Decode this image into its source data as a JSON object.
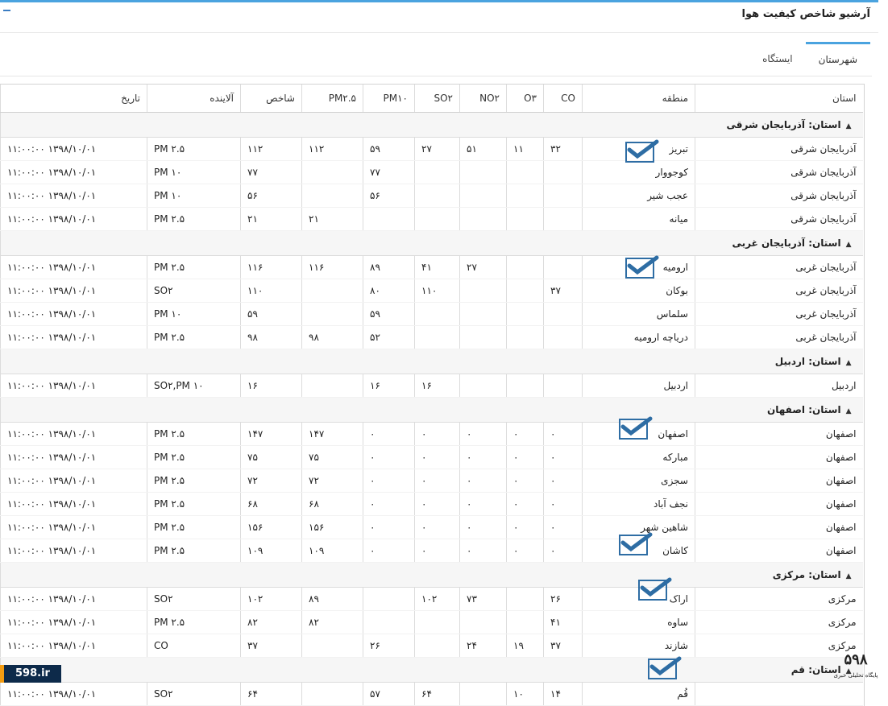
{
  "panel": {
    "title": "آرشیو شاخص کیفیت هوا"
  },
  "tabs": [
    {
      "label": "شهرستان",
      "active": true
    },
    {
      "label": "ایستگاه",
      "active": false
    }
  ],
  "columns": [
    "استان",
    "منطقه",
    "CO",
    "O۳",
    "NO۲",
    "SO۲",
    "PM۱۰",
    "PM۲.۵",
    "شاخص",
    "آلاینده",
    "تاریخ"
  ],
  "groups": [
    {
      "label": "استان: آذربایجان شرقی",
      "rows": [
        [
          "آذربایجان شرقی",
          "تبریز",
          "۳۲",
          "۱۱",
          "۵۱",
          "۲۷",
          "۵۹",
          "۱۱۲",
          "۱۱۲",
          "PM ۲.۵",
          "۱۱:۰۰:۰۰ ۱۳۹۸/۱۰/۰۱"
        ],
        [
          "آذربایجان شرقی",
          "کوجووار",
          "",
          "",
          "",
          "",
          "۷۷",
          "",
          "۷۷",
          "PM ۱۰",
          "۱۱:۰۰:۰۰ ۱۳۹۸/۱۰/۰۱"
        ],
        [
          "آذربایجان شرقی",
          "عجب شیر",
          "",
          "",
          "",
          "",
          "۵۶",
          "",
          "۵۶",
          "PM ۱۰",
          "۱۱:۰۰:۰۰ ۱۳۹۸/۱۰/۰۱"
        ],
        [
          "آذربایجان شرقی",
          "میانه",
          "",
          "",
          "",
          "",
          "",
          "۲۱",
          "۲۱",
          "PM ۲.۵",
          "۱۱:۰۰:۰۰ ۱۳۹۸/۱۰/۰۱"
        ]
      ]
    },
    {
      "label": "استان: آذربایجان غربی",
      "rows": [
        [
          "آذربایجان غربی",
          "ارومیه",
          "",
          "",
          "۲۷",
          "۴۱",
          "۸۹",
          "۱۱۶",
          "۱۱۶",
          "PM ۲.۵",
          "۱۱:۰۰:۰۰ ۱۳۹۸/۱۰/۰۱"
        ],
        [
          "آذربایجان غربی",
          "بوکان",
          "۳۷",
          "",
          "",
          "۱۱۰",
          "۸۰",
          "",
          "۱۱۰",
          "SO۲",
          "۱۱:۰۰:۰۰ ۱۳۹۸/۱۰/۰۱"
        ],
        [
          "آذربایجان غربی",
          "سلماس",
          "",
          "",
          "",
          "",
          "۵۹",
          "",
          "۵۹",
          "PM ۱۰",
          "۱۱:۰۰:۰۰ ۱۳۹۸/۱۰/۰۱"
        ],
        [
          "آذربایجان غربی",
          "دریاچه ارومیه",
          "",
          "",
          "",
          "",
          "۵۲",
          "۹۸",
          "۹۸",
          "PM ۲.۵",
          "۱۱:۰۰:۰۰ ۱۳۹۸/۱۰/۰۱"
        ]
      ]
    },
    {
      "label": "استان: اردبیل",
      "rows": [
        [
          "اردبیل",
          "اردبیل",
          "",
          "",
          "",
          "۱۶",
          "۱۶",
          "",
          "۱۶",
          "SO۲,PM ۱۰",
          "۱۱:۰۰:۰۰ ۱۳۹۸/۱۰/۰۱"
        ]
      ]
    },
    {
      "label": "استان: اصفهان",
      "rows": [
        [
          "اصفهان",
          "اصفهان",
          "۰",
          "۰",
          "۰",
          "۰",
          "۰",
          "۱۴۷",
          "۱۴۷",
          "PM ۲.۵",
          "۱۱:۰۰:۰۰ ۱۳۹۸/۱۰/۰۱"
        ],
        [
          "اصفهان",
          "مبارکه",
          "۰",
          "۰",
          "۰",
          "۰",
          "۰",
          "۷۵",
          "۷۵",
          "PM ۲.۵",
          "۱۱:۰۰:۰۰ ۱۳۹۸/۱۰/۰۱"
        ],
        [
          "اصفهان",
          "سجزی",
          "۰",
          "۰",
          "۰",
          "۰",
          "۰",
          "۷۲",
          "۷۲",
          "PM ۲.۵",
          "۱۱:۰۰:۰۰ ۱۳۹۸/۱۰/۰۱"
        ],
        [
          "اصفهان",
          "نجف آباد",
          "۰",
          "۰",
          "۰",
          "۰",
          "۰",
          "۶۸",
          "۶۸",
          "PM ۲.۵",
          "۱۱:۰۰:۰۰ ۱۳۹۸/۱۰/۰۱"
        ],
        [
          "اصفهان",
          "شاهین شهر",
          "۰",
          "۰",
          "۰",
          "۰",
          "۰",
          "۱۵۶",
          "۱۵۶",
          "PM ۲.۵",
          "۱۱:۰۰:۰۰ ۱۳۹۸/۱۰/۰۱"
        ],
        [
          "اصفهان",
          "کاشان",
          "۰",
          "۰",
          "۰",
          "۰",
          "۰",
          "۱۰۹",
          "۱۰۹",
          "PM ۲.۵",
          "۱۱:۰۰:۰۰ ۱۳۹۸/۱۰/۰۱"
        ]
      ]
    },
    {
      "label": "استان: مرکزی",
      "rows": [
        [
          "مرکزی",
          "اراک",
          "۲۶",
          "",
          "۷۳",
          "۱۰۲",
          "",
          "۸۹",
          "۱۰۲",
          "SO۲",
          "۱۱:۰۰:۰۰ ۱۳۹۸/۱۰/۰۱"
        ],
        [
          "مرکزی",
          "ساوه",
          "۴۱",
          "",
          "",
          "",
          "",
          "۸۲",
          "۸۲",
          "PM ۲.۵",
          "۱۱:۰۰:۰۰ ۱۳۹۸/۱۰/۰۱"
        ],
        [
          "مرکزی",
          "شازند",
          "۳۷",
          "۱۹",
          "۲۴",
          "",
          "۲۶",
          "",
          "۳۷",
          "CO",
          "۱۱:۰۰:۰۰ ۱۳۹۸/۱۰/۰۱"
        ]
      ]
    },
    {
      "label": "استان: قم",
      "rows": [
        [
          "",
          "قُم",
          "۱۴",
          "۱۰",
          "",
          "۶۴",
          "۵۷",
          "",
          "۶۴",
          "SO۲",
          "۱۱:۰۰:۰۰ ۱۳۹۸/۱۰/۰۱"
        ]
      ]
    }
  ],
  "logos": {
    "left": "598.ir",
    "right_main": "۵۹۸",
    "right_sub": "پایگاه تحلیلی خبری"
  },
  "colors": {
    "accent": "#4aa3df",
    "check": "#2e6da4"
  }
}
